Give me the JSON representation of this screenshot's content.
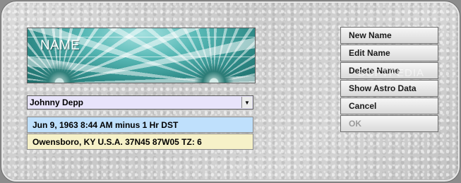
{
  "banner": {
    "title": "NAME"
  },
  "name_select": {
    "value": "Johnny Depp",
    "arrow_icon": "chevron-down-icon"
  },
  "birth_info": {
    "datetime": "Jun 9, 1963  8:44 AM  minus 1 Hr DST",
    "location": "Owensboro, KY U.S.A.  37N45  87W05 TZ: 6"
  },
  "buttons": {
    "new_name": "New Name",
    "edit_name": "Edit Name",
    "delete_name": "Delete Name",
    "show_astro": "Show Astro Data",
    "cancel": "Cancel",
    "ok": "OK"
  },
  "watermark": "SOFTPEDIA",
  "colors": {
    "date_bg": "#bfe0fc",
    "location_bg": "#f6f1c8",
    "select_bg": "#e8e4fb",
    "banner_teal": "#58b9b6"
  }
}
